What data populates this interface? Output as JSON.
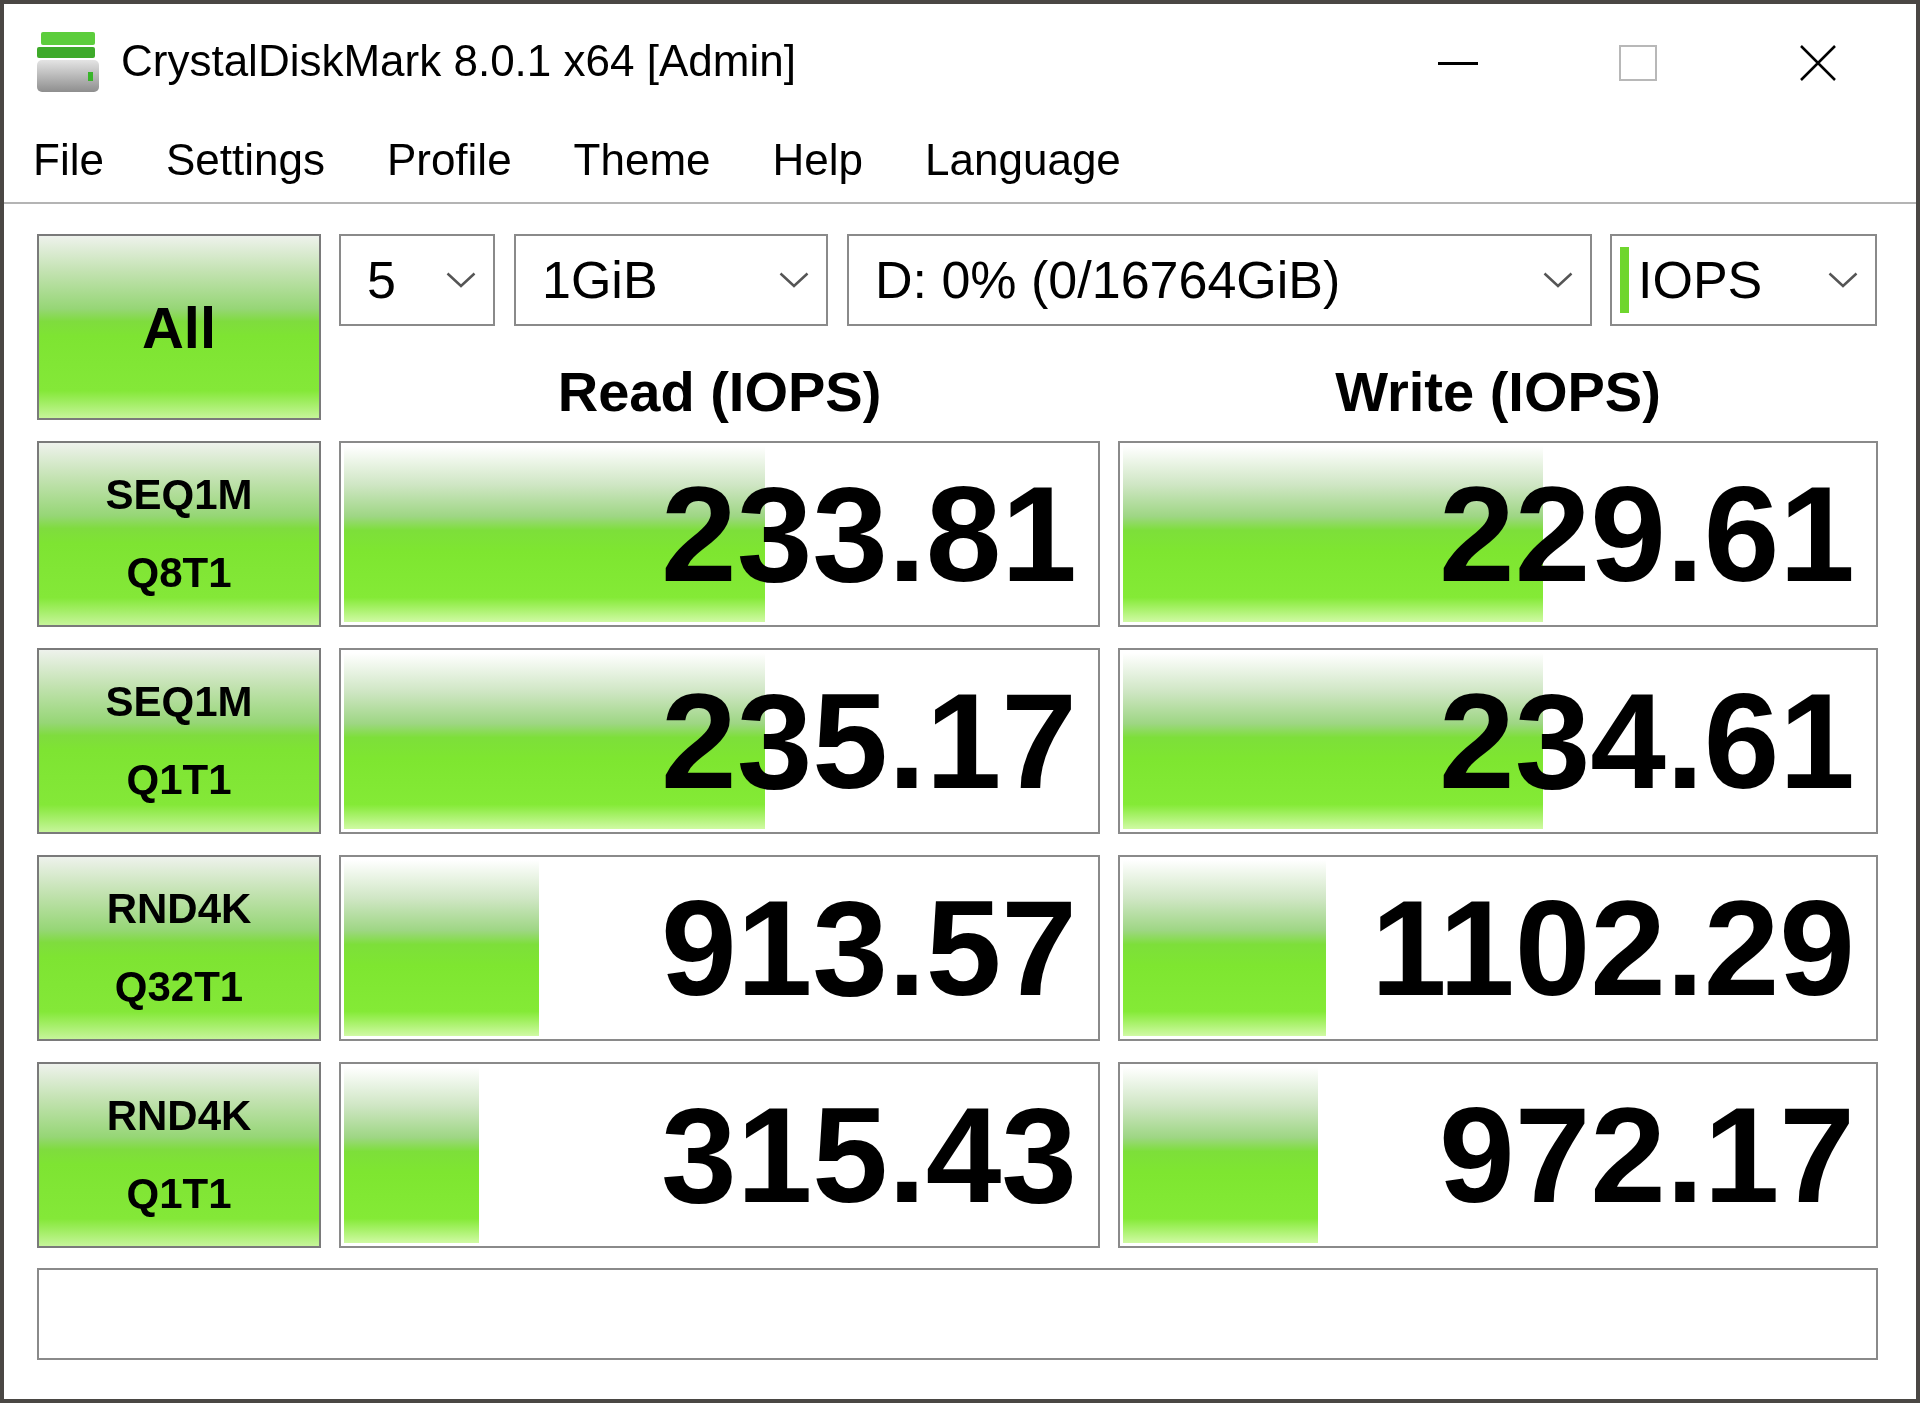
{
  "window": {
    "title": "CrystalDiskMark 8.0.1 x64 [Admin]"
  },
  "caption_buttons": [
    {
      "kind": "minimize",
      "disabled": false
    },
    {
      "kind": "maximize",
      "disabled": true
    },
    {
      "kind": "close",
      "disabled": false
    }
  ],
  "menu": [
    "File",
    "Settings",
    "Profile",
    "Theme",
    "Help",
    "Language"
  ],
  "run_all_button": "All",
  "dropdowns": [
    {
      "kind": "count",
      "value": "5"
    },
    {
      "kind": "size",
      "value": "1GiB"
    },
    {
      "kind": "drive",
      "value": "D: 0% (0/16764GiB)"
    },
    {
      "kind": "unit",
      "value": "IOPS"
    }
  ],
  "columns": [
    "Read (IOPS)",
    "Write (IOPS)"
  ],
  "tests": [
    {
      "name": "SEQ1M",
      "params": "Q8T1",
      "read": {
        "value": "233.81",
        "level": 0.56
      },
      "write": {
        "value": "229.61",
        "level": 0.56
      }
    },
    {
      "name": "SEQ1M",
      "params": "Q1T1",
      "read": {
        "value": "235.17",
        "level": 0.56
      },
      "write": {
        "value": "234.61",
        "level": 0.56
      }
    },
    {
      "name": "RND4K",
      "params": "Q32T1",
      "read": {
        "value": "913.57",
        "level": 0.26
      },
      "write": {
        "value": "1102.29",
        "level": 0.27
      }
    },
    {
      "name": "RND4K",
      "params": "Q1T1",
      "read": {
        "value": "315.43",
        "level": 0.18
      },
      "write": {
        "value": "972.17",
        "level": 0.26
      }
    }
  ]
}
